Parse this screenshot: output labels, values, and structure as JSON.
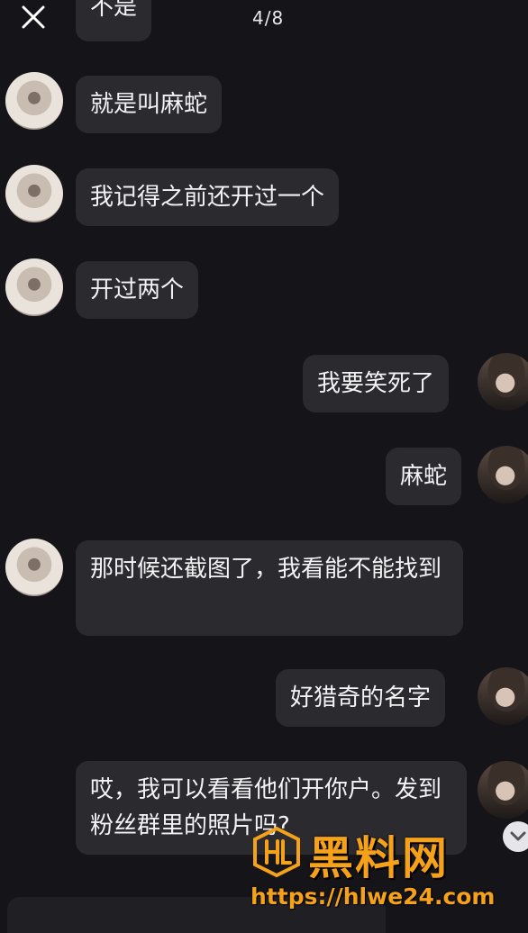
{
  "header": {
    "close_icon": "close-icon",
    "counter": "4/8"
  },
  "messages": [
    {
      "side": "left",
      "text": "不是"
    },
    {
      "side": "left",
      "text": "就是叫麻蛇"
    },
    {
      "side": "left",
      "text": "我记得之前还开过一个"
    },
    {
      "side": "left",
      "text": "开过两个"
    },
    {
      "side": "right",
      "text": "我要笑死了"
    },
    {
      "side": "right",
      "text": "麻蛇"
    },
    {
      "side": "left",
      "text": "那时候还截图了，我看能不能找到"
    },
    {
      "side": "right",
      "text": "好猎奇的名字"
    },
    {
      "side": "left",
      "text": "哎，我可以看看他们开你户。发到粉丝群里的照片吗?"
    }
  ],
  "watermark": {
    "title": "黑料网",
    "url": "https://hlwe24.com"
  },
  "colors": {
    "background": "#151419",
    "bubble": "#2a2a2f",
    "watermark": "#f5a11a"
  }
}
